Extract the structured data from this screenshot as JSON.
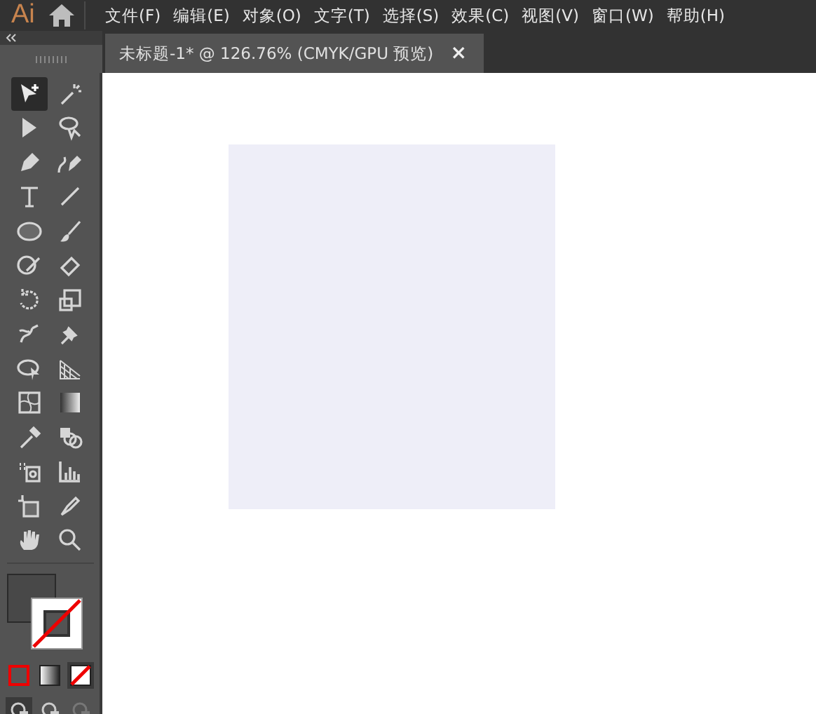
{
  "app": {
    "logo": "Ai"
  },
  "menu": [
    "文件(F)",
    "编辑(E)",
    "对象(O)",
    "文字(T)",
    "选择(S)",
    "效果(C)",
    "视图(V)",
    "窗口(W)",
    "帮助(H)"
  ],
  "document_tab": {
    "title": "未标题-1* @ 126.76% (CMYK/GPU 预览)",
    "close": "×",
    "selected": true
  },
  "tools": [
    {
      "kind": "selection",
      "selected": true
    },
    {
      "kind": "wand",
      "selected": false
    },
    {
      "kind": "direct",
      "selected": false
    },
    {
      "kind": "lasso",
      "selected": false
    },
    {
      "kind": "pen",
      "selected": false
    },
    {
      "kind": "curvature",
      "selected": false
    },
    {
      "kind": "type",
      "selected": false
    },
    {
      "kind": "line",
      "selected": false
    },
    {
      "kind": "ellipse",
      "selected": false
    },
    {
      "kind": "brush",
      "selected": false
    },
    {
      "kind": "shaper",
      "selected": false
    },
    {
      "kind": "eraser",
      "selected": false
    },
    {
      "kind": "rotate",
      "selected": false
    },
    {
      "kind": "scale",
      "selected": false
    },
    {
      "kind": "warp",
      "selected": false
    },
    {
      "kind": "pin",
      "selected": false
    },
    {
      "kind": "shapebuilder",
      "selected": false
    },
    {
      "kind": "perspective",
      "selected": false
    },
    {
      "kind": "mesh",
      "selected": false
    },
    {
      "kind": "gradient",
      "selected": false
    },
    {
      "kind": "eyedropper",
      "selected": false
    },
    {
      "kind": "blend",
      "selected": false
    },
    {
      "kind": "spray",
      "selected": false
    },
    {
      "kind": "graph",
      "selected": false
    },
    {
      "kind": "artboard",
      "selected": false
    },
    {
      "kind": "knife",
      "selected": false
    },
    {
      "kind": "hand",
      "selected": false
    },
    {
      "kind": "zoom",
      "selected": false
    }
  ],
  "color_modes": [
    {
      "kind": "color",
      "selected": false
    },
    {
      "kind": "gradient",
      "selected": false
    },
    {
      "kind": "none",
      "selected": true
    }
  ],
  "draw_modes": [
    {
      "selected": true
    },
    {
      "selected": false
    },
    {
      "selected": false
    }
  ]
}
